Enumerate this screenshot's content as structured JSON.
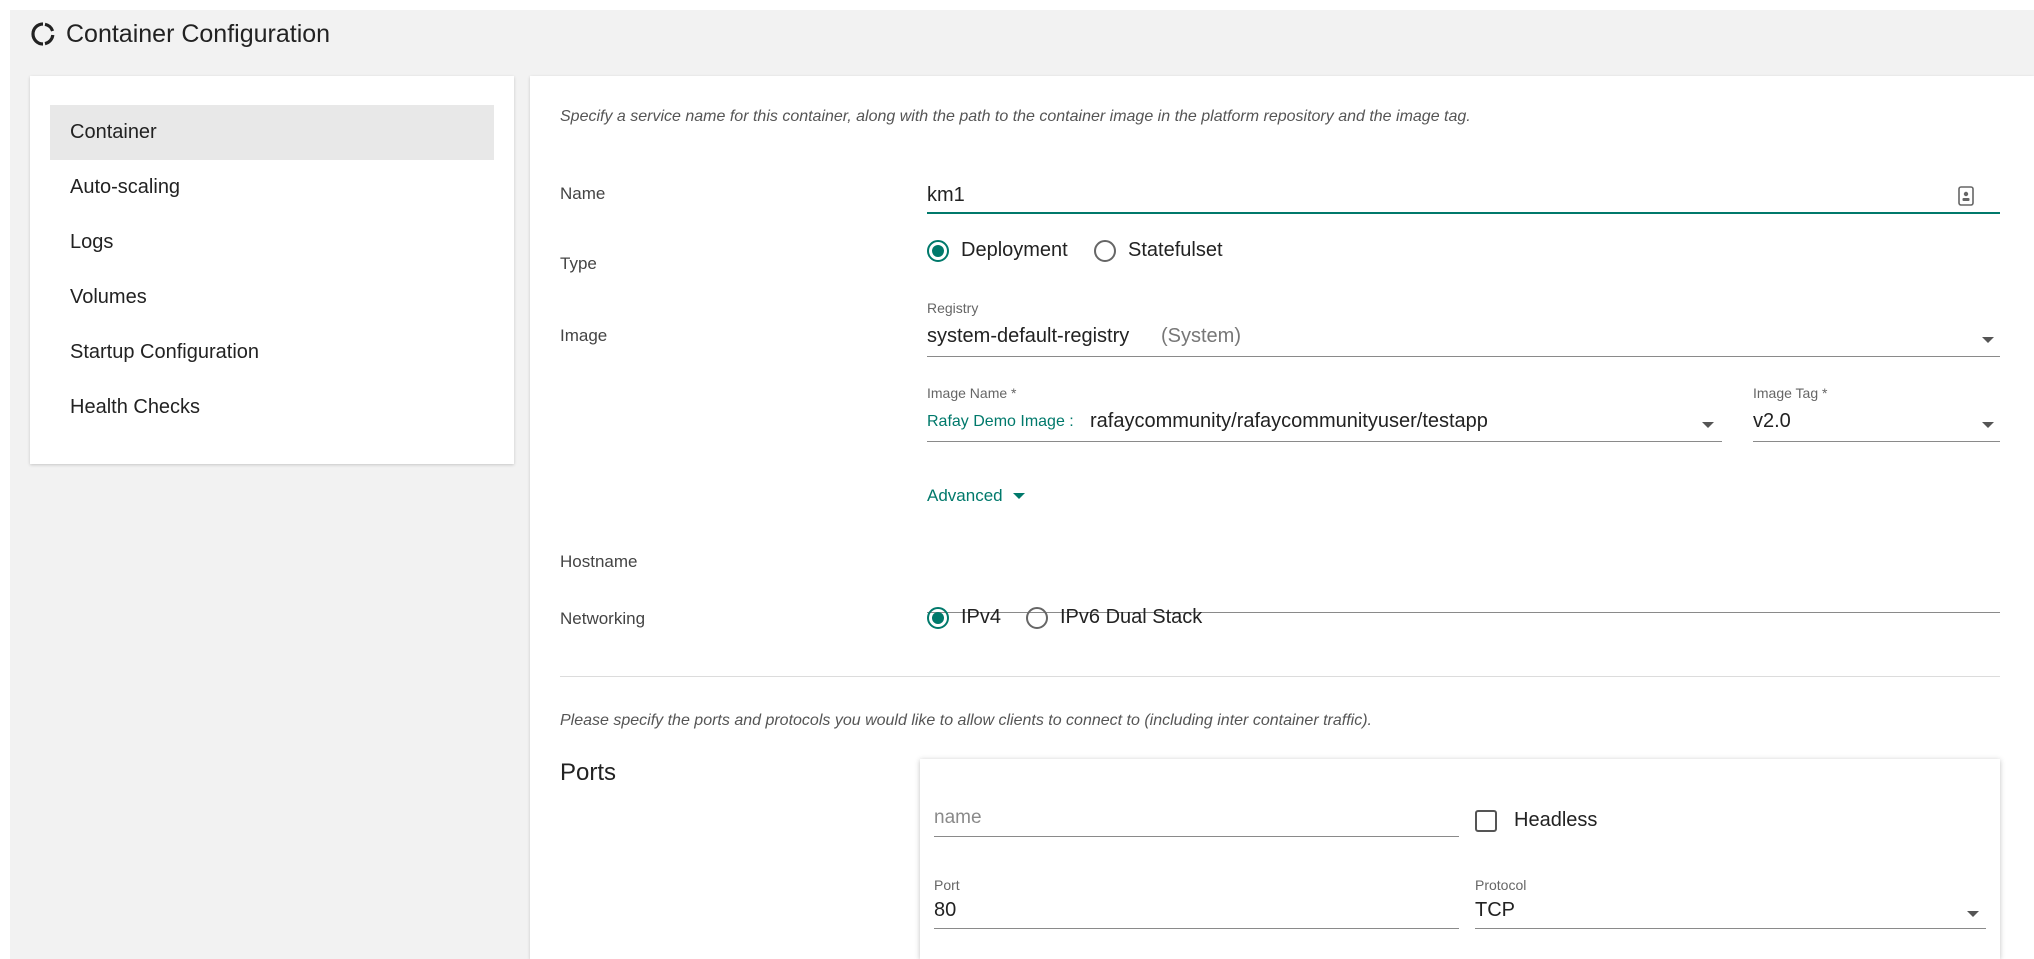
{
  "header": {
    "title": "Container Configuration",
    "icon": "loading-circle-icon"
  },
  "sidebar": {
    "items": [
      {
        "label": "Container",
        "active": true
      },
      {
        "label": "Auto-scaling"
      },
      {
        "label": "Logs"
      },
      {
        "label": "Volumes"
      },
      {
        "label": "Startup Configuration"
      },
      {
        "label": "Health Checks"
      }
    ]
  },
  "main": {
    "intro": "Specify a service name for this container, along with the path to the container image in the platform repository and the image tag.",
    "name": {
      "label": "Name",
      "value": "km1"
    },
    "type": {
      "label": "Type",
      "options": [
        "Deployment",
        "Statefulset"
      ],
      "selected": "Deployment"
    },
    "image": {
      "label": "Image",
      "registry_label": "Registry",
      "registry_value": "system-default-registry",
      "registry_sub": "(System)",
      "image_name_label": "Image Name *",
      "image_name_prefix": "Rafay Demo Image :",
      "image_name_value": "rafaycommunity/rafaycommunityuser/testapp",
      "image_tag_label": "Image Tag *",
      "image_tag_value": "v2.0"
    },
    "advanced_label": "Advanced",
    "hostname": {
      "label": "Hostname",
      "value": ""
    },
    "networking": {
      "label": "Networking",
      "options": [
        "IPv4",
        "IPv6 Dual Stack"
      ],
      "selected": "IPv4"
    },
    "ports_intro": "Please specify the ports and protocols you would like to allow clients to connect to (including inter container traffic).",
    "ports_title": "Ports",
    "port_card": {
      "name_placeholder": "name",
      "headless_label": "Headless",
      "port_label": "Port",
      "port_value": "80",
      "protocol_label": "Protocol",
      "protocol_value": "TCP"
    }
  },
  "colors": {
    "accent": "#00796b",
    "page_bg": "#f2f2f2"
  }
}
